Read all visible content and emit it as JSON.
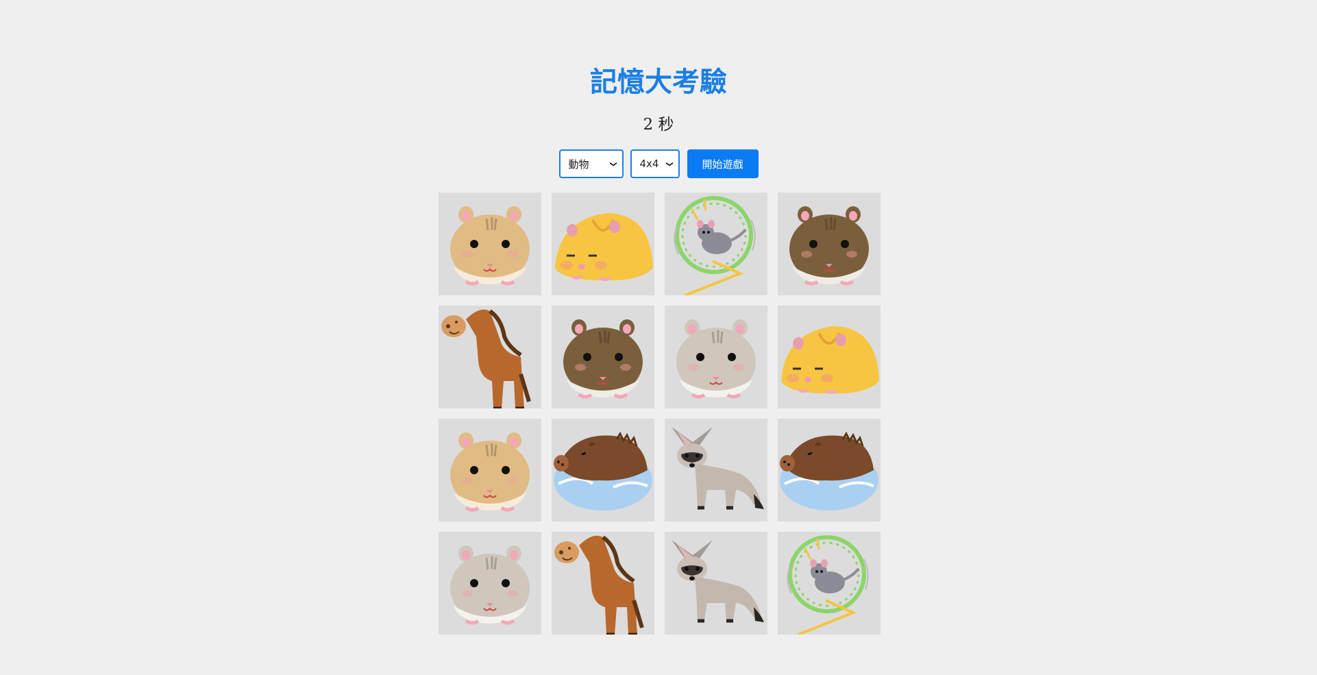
{
  "header": {
    "title": "記憶大考驗",
    "timer": "2 秒"
  },
  "controls": {
    "category_selected": "動物",
    "size_selected": "4x4",
    "start_label": "開始遊戲"
  },
  "board": {
    "rows": 4,
    "cols": 4,
    "cards": [
      "hamster-tan",
      "hamster-yellow-sleeping",
      "hamster-wheel",
      "hamster-brown",
      "horse",
      "hamster-brown",
      "hamster-gray",
      "hamster-yellow-sleeping",
      "hamster-tan",
      "boar-swimming",
      "fox-gray",
      "boar-swimming",
      "hamster-gray",
      "horse",
      "fox-gray",
      "hamster-wheel"
    ]
  },
  "colors": {
    "accent": "#1a7fe3",
    "button": "#0a7bf2",
    "background": "#efefef",
    "card_bg": "#dcdcdc"
  }
}
